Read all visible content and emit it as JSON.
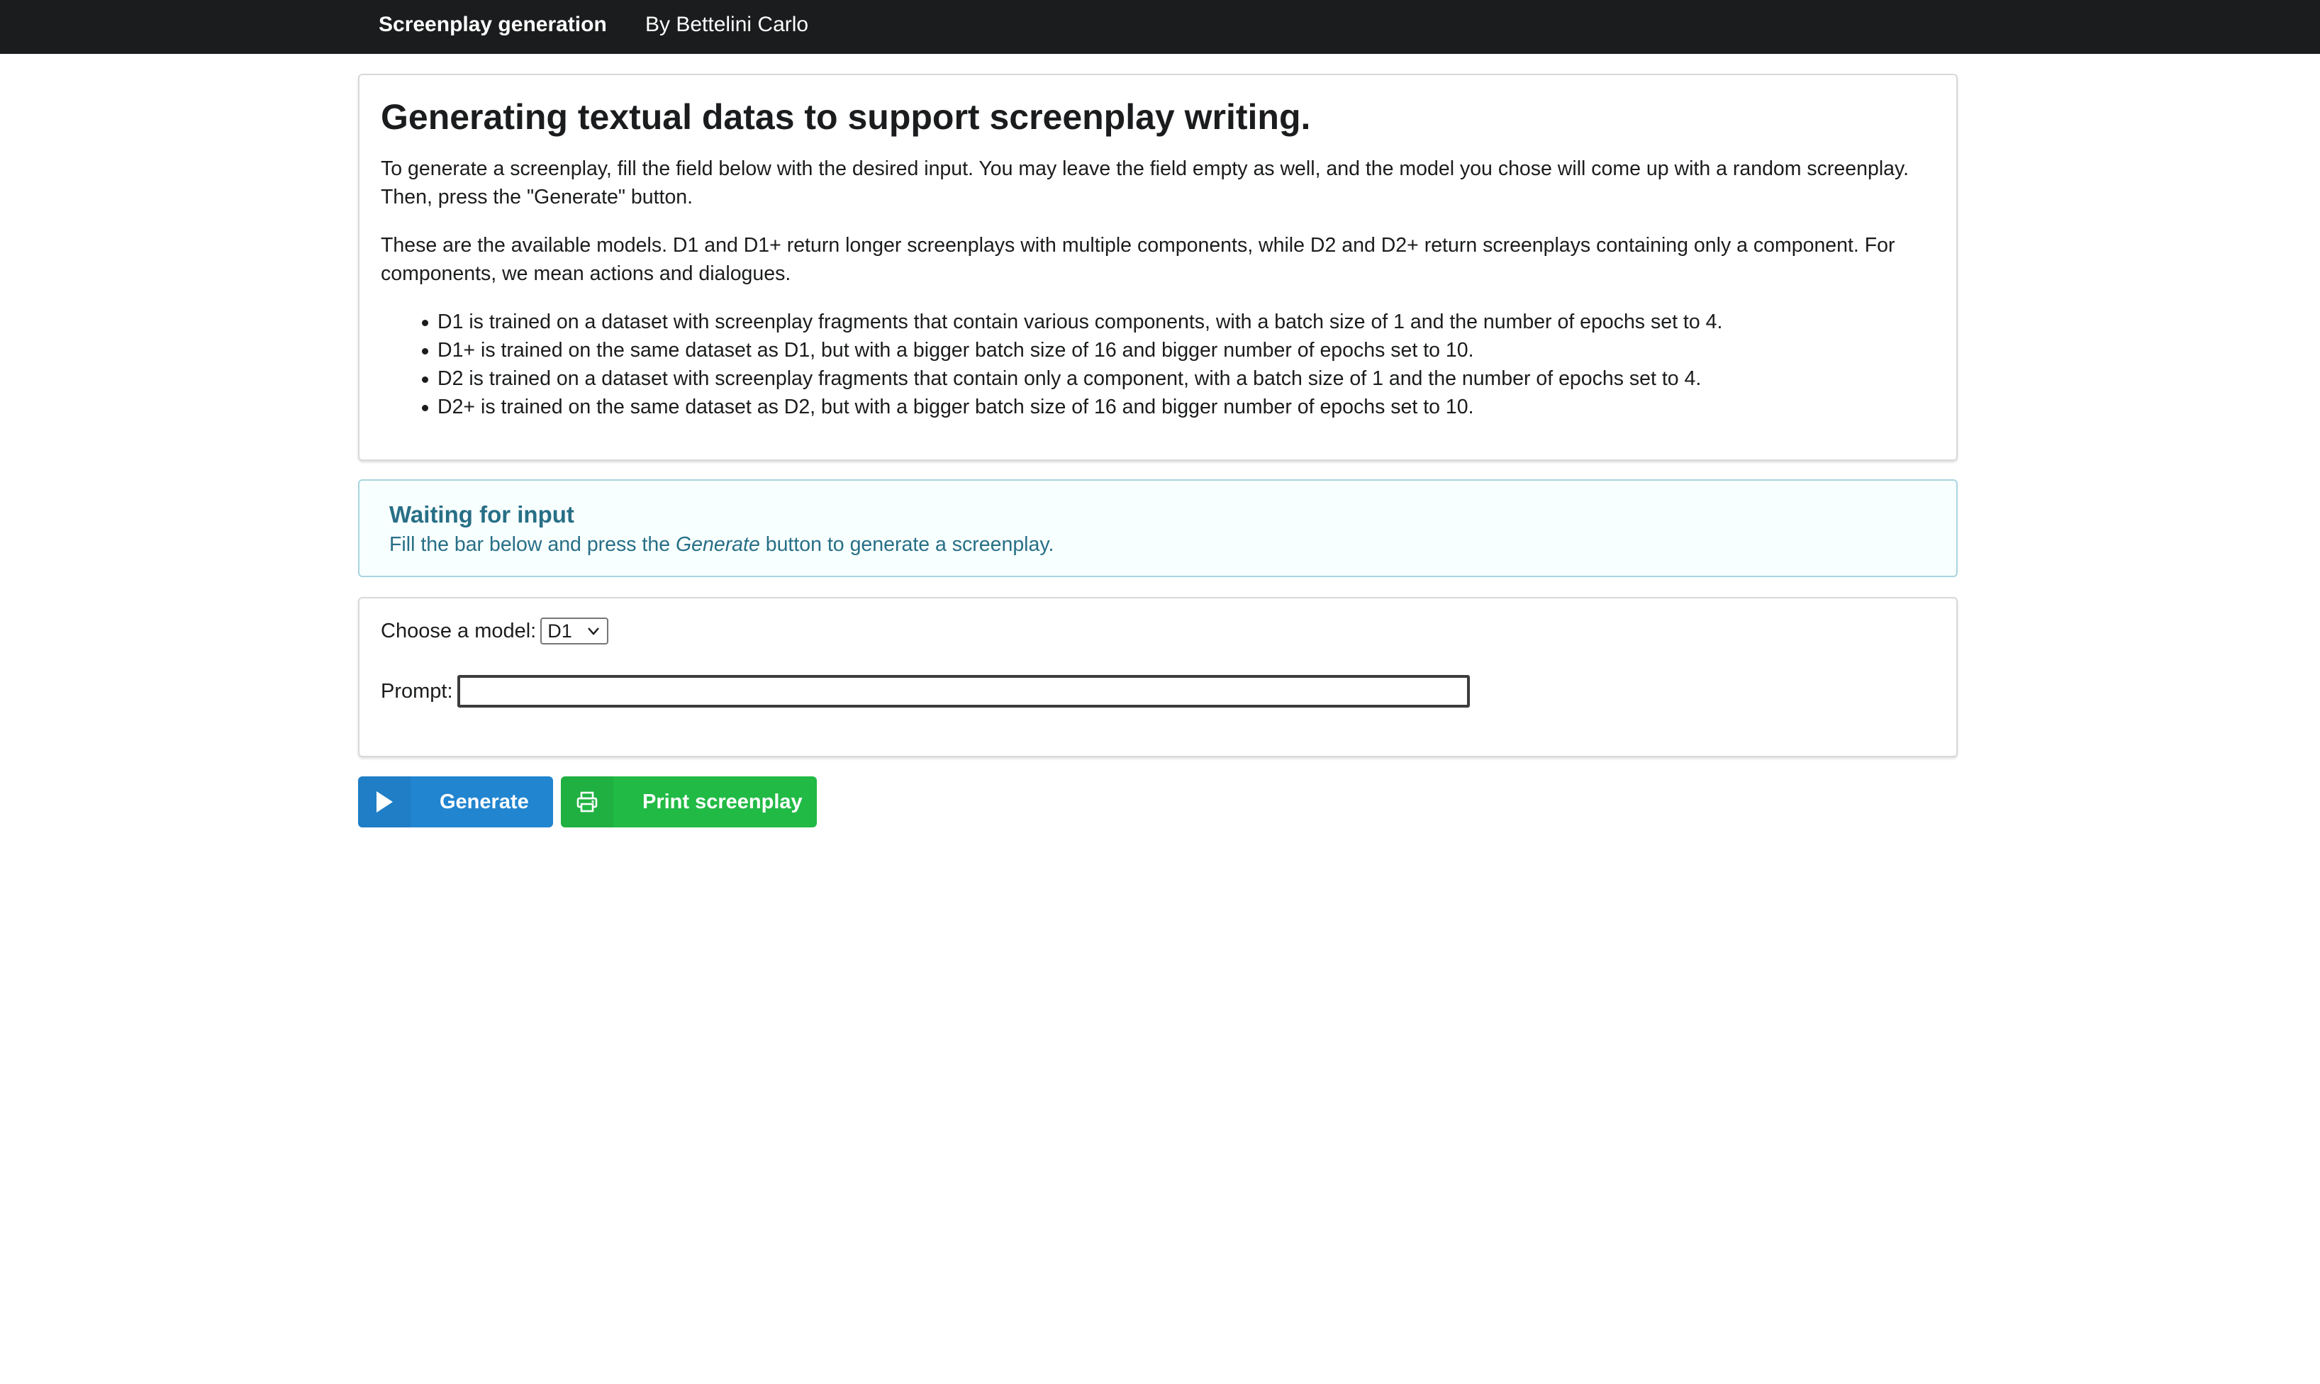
{
  "navbar": {
    "brand": "Screenplay generation",
    "author": "By Bettelini Carlo"
  },
  "intro": {
    "title": "Generating textual datas to support screenplay writing.",
    "paragraph_1": "To generate a screenplay, fill the field below with the desired input. You may leave the field empty as well, and the model you chose will come up with a random screenplay. Then, press the \"Generate\" button.",
    "paragraph_2": "These are the available models. D1 and D1+ return longer screenplays with multiple components, while D2 and D2+ return screenplays containing only a component. For components, we mean actions and dialogues.",
    "models": [
      "D1 is trained on a dataset with screenplay fragments that contain various components, with a batch size of 1 and the number of epochs set to 4.",
      "D1+ is trained on the same dataset as D1, but with a bigger batch size of 16 and bigger number of epochs set to 10.",
      "D2 is trained on a dataset with screenplay fragments that contain only a component, with a batch size of 1 and the number of epochs set to 4.",
      "D2+ is trained on the same dataset as D2, but with a bigger batch size of 16 and bigger number of epochs set to 10."
    ]
  },
  "message": {
    "header": "Waiting for input",
    "body_before": "Fill the bar below and press the ",
    "body_emphasis": "Generate",
    "body_after": " button to generate a screenplay."
  },
  "form": {
    "model_label": "Choose a model:",
    "model_selected": "D1",
    "prompt_label": "Prompt:",
    "prompt_value": "",
    "prompt_placeholder": ""
  },
  "buttons": {
    "generate_label": "Generate",
    "print_label": "Print screenplay"
  },
  "icons": {
    "generate": "play-icon",
    "print": "print-icon",
    "select": "chevron-down-icon"
  },
  "colors": {
    "navbar": "#1b1c1d",
    "generate_button": "#2185d0",
    "print_button": "#21ba45",
    "message_text": "#276f86",
    "message_background": "#f8ffff",
    "message_border": "#a9d5de"
  }
}
